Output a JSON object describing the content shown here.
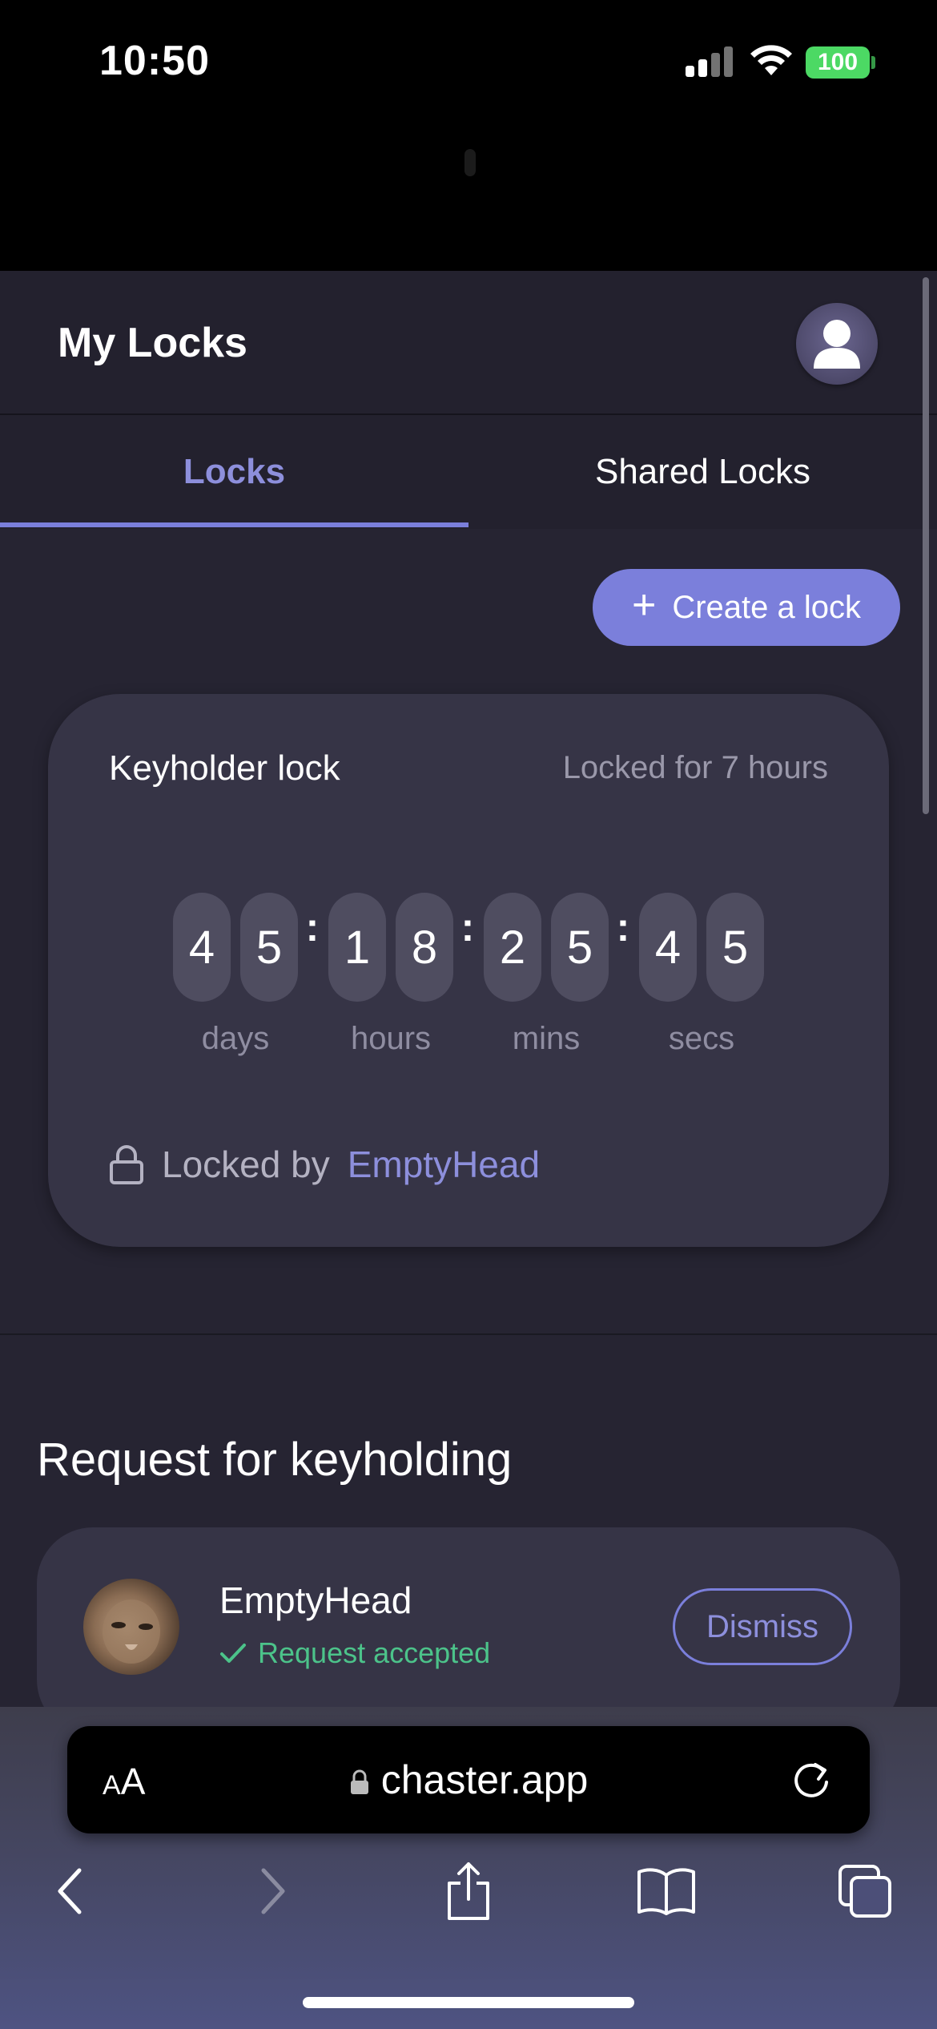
{
  "status_bar": {
    "time": "10:50",
    "battery": "100"
  },
  "header": {
    "title": "My Locks",
    "avatar_icon": "user-avatar-icon"
  },
  "tabs": [
    {
      "label": "Locks",
      "active": true
    },
    {
      "label": "Shared Locks",
      "active": false
    }
  ],
  "create_button": {
    "label": "Create a lock",
    "icon": "plus-icon"
  },
  "lock_card": {
    "title": "Keyholder lock",
    "locked_duration": "Locked for 7 hours",
    "timer": {
      "digits": [
        "4",
        "5",
        "1",
        "8",
        "2",
        "5",
        "4",
        "5"
      ],
      "separator": ":",
      "units": [
        "days",
        "hours",
        "mins",
        "secs"
      ]
    },
    "locked_by_prefix": "Locked by",
    "keyholder": "EmptyHead"
  },
  "requests": {
    "section_title": "Request for keyholding",
    "items": [
      {
        "name": "EmptyHead",
        "status": "Request accepted",
        "action": "Dismiss"
      }
    ]
  },
  "browser": {
    "text_size_small": "A",
    "text_size_big": "A",
    "url": "chaster.app"
  },
  "colors": {
    "accent": "#7b7fdb",
    "success": "#4cc38a",
    "background": "#262432",
    "card": "#363446"
  }
}
